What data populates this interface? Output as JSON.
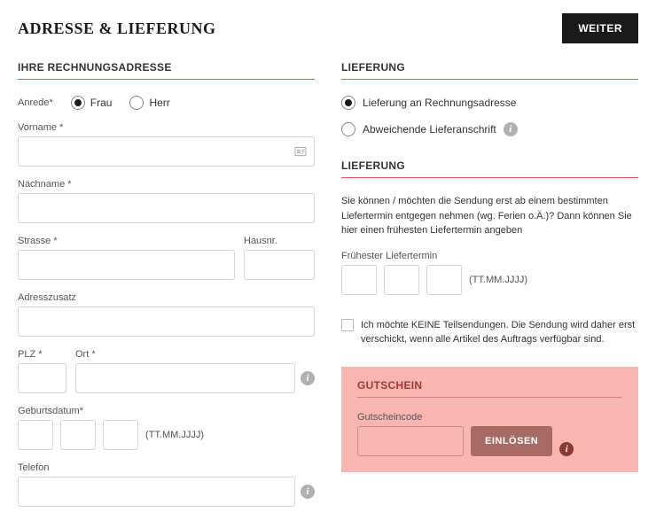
{
  "header": {
    "title": "ADRESSE & LIEFERUNG",
    "continue_btn": "WEITER"
  },
  "billing": {
    "section_title": "IHRE RECHNUNGSADRESSE",
    "salutation_label": "Anrede*",
    "salutation_options": [
      "Frau",
      "Herr"
    ],
    "salutation_selected": "Frau",
    "firstname_label": "Vorname *",
    "lastname_label": "Nachname *",
    "street_label": "Strasse *",
    "houseno_label": "Hausnr.",
    "addon_label": "Adresszusatz",
    "zip_label": "PLZ *",
    "city_label": "Ort *",
    "dob_label": "Geburtsdatum*",
    "date_hint": "(TT.MM.JJJJ)",
    "phone_label": "Telefon"
  },
  "shipping": {
    "section_title": "LIEFERUNG",
    "opt_billing": "Lieferung an Rechnungsadresse",
    "opt_alt": "Abweichende Lieferanschrift",
    "selected": "billing"
  },
  "deliveryDate": {
    "section_title": "LIEFERUNG",
    "hint": "Sie können / möchten die Sendung erst ab einem bestimmten Liefertermin entgegen nehmen (wg. Ferien o.Ä.)? Dann können Sie hier einen frühesten Liefertermin angeben",
    "earliest_label": "Frühester Liefertermin",
    "date_hint": "(TT.MM.JJJJ)"
  },
  "partialShip": {
    "label": "Ich möchte KEINE Teilsendungen. Die Sendung wird daher erst verschickt, wenn alle Artikel des Auftrags verfügbar sind."
  },
  "coupon": {
    "section_title": "GUTSCHEIN",
    "code_label": "Gutscheincode",
    "redeem_btn": "EINLÖSEN"
  }
}
